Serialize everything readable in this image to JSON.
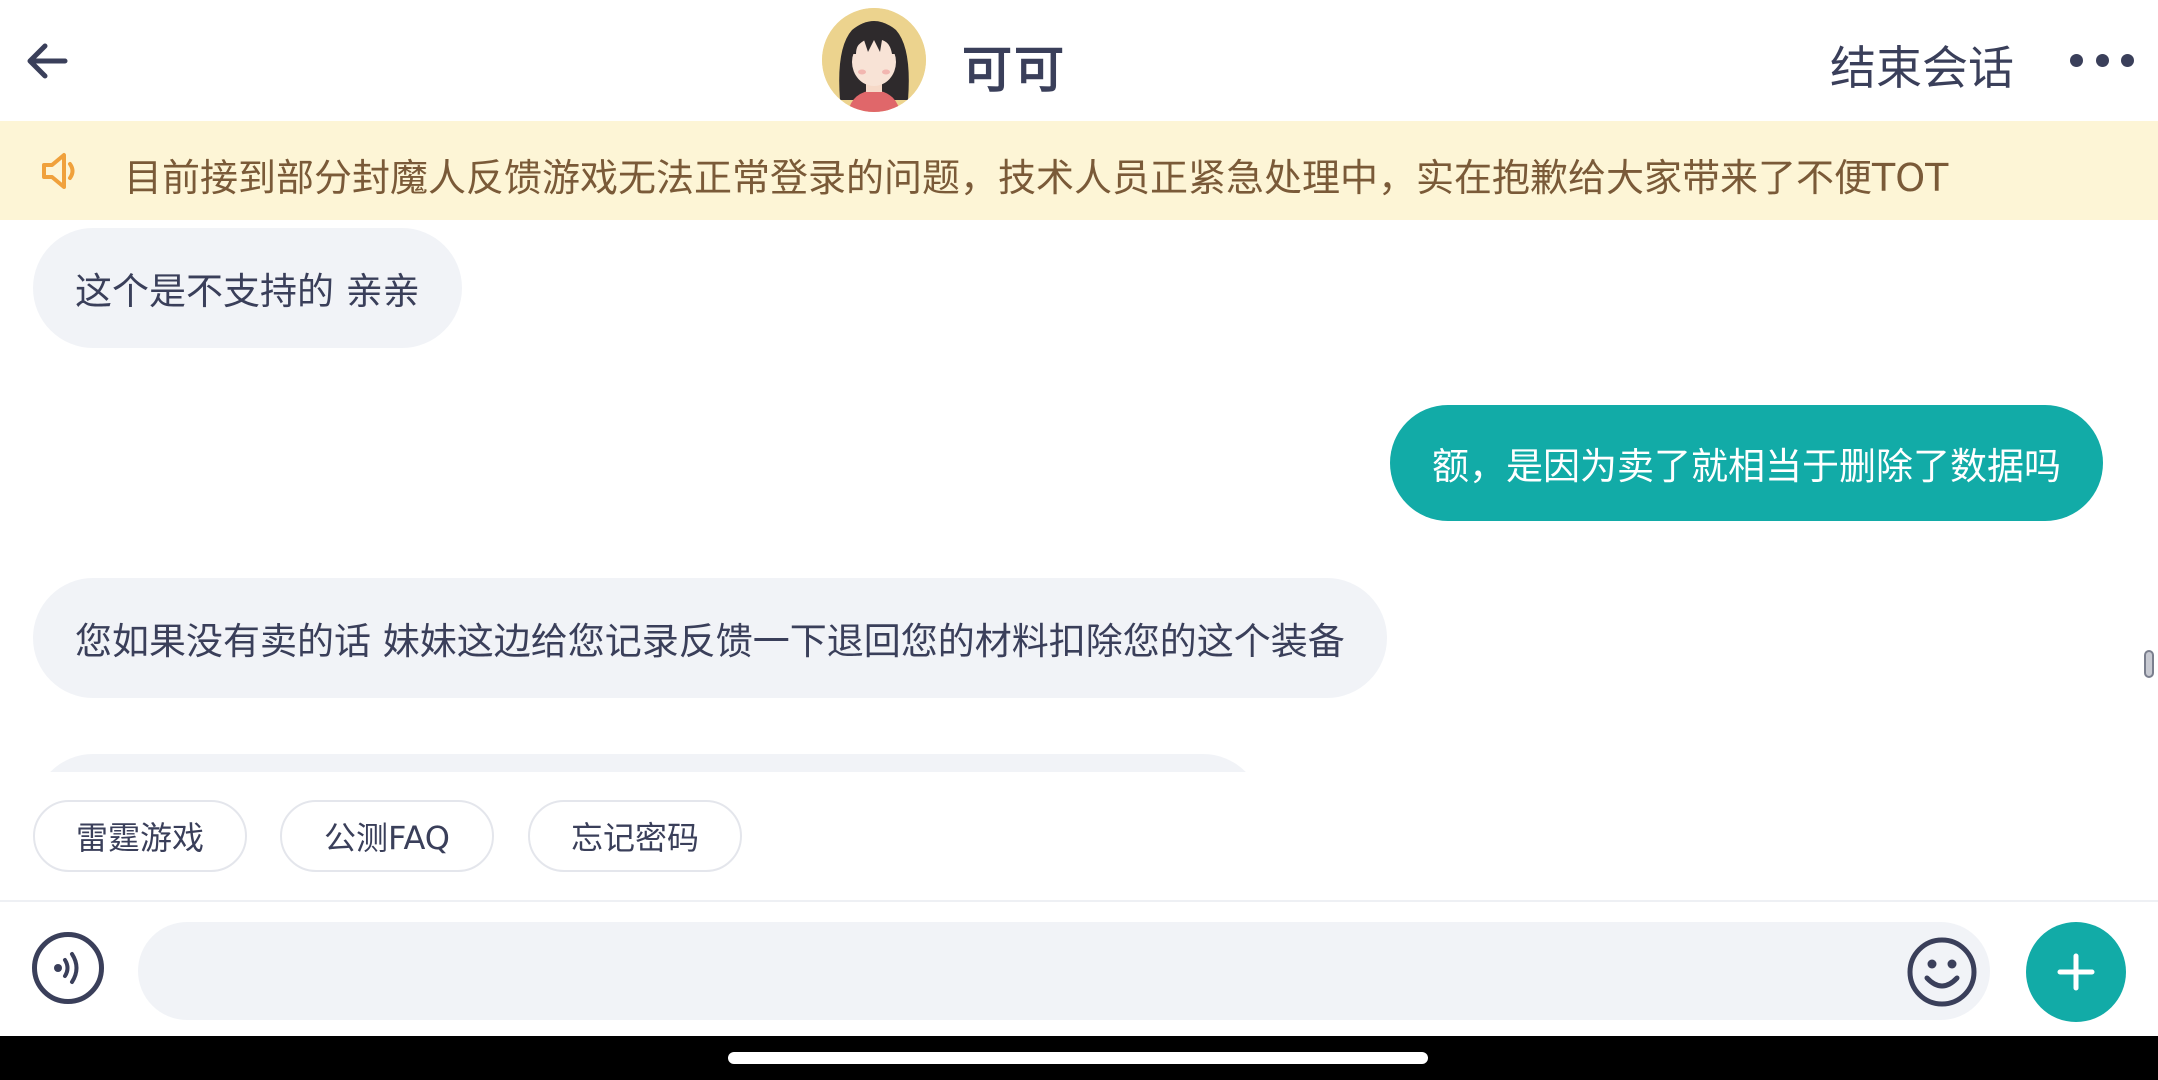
{
  "header": {
    "back_icon": "arrow-left-icon",
    "agent_name": "可可",
    "end_session_label": "结束会话",
    "more_icon": "more-dots-icon"
  },
  "notice": {
    "icon": "speaker-icon",
    "text": "目前接到部分封魔人反馈游戏无法正常登录的问题，技术人员正紧急处理中，实在抱歉给大家带来了不便TOT",
    "accent_color": "#f0a13c",
    "background_color": "#fdf5d6"
  },
  "messages": [
    {
      "from": "agent",
      "text": "这个是不支持的 亲亲"
    },
    {
      "from": "user",
      "text": "额，是因为卖了就相当于删除了数据吗"
    },
    {
      "from": "agent",
      "text": "您如果没有卖的话 妹妹这边给您记录反馈一下退回您的材料扣除您的这个装备"
    }
  ],
  "quick_replies": [
    "雷霆游戏",
    "公测FAQ",
    "忘记密码"
  ],
  "input": {
    "placeholder": "",
    "value": "",
    "voice_icon": "voice-wave-icon",
    "emoji_icon": "smiley-icon",
    "plus_icon": "plus-icon"
  },
  "colors": {
    "accent": "#12aba7",
    "text": "#3a3f5a",
    "agent_bubble": "#f1f3f7"
  }
}
